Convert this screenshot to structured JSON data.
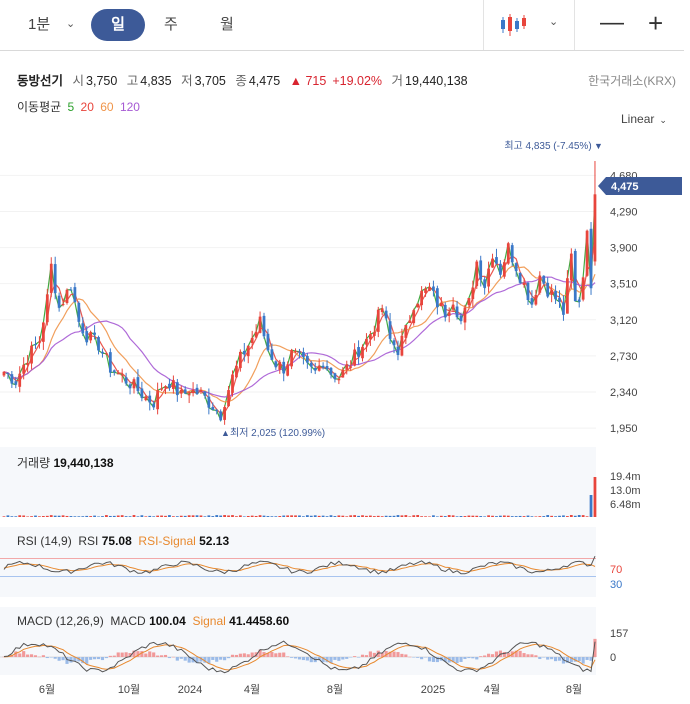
{
  "toolbar": {
    "timeframes": [
      "1분",
      "일",
      "주",
      "월"
    ],
    "active": "일",
    "chart_type_icon": "candlestick-icon",
    "zoom_out_icon": "minus-icon",
    "zoom_in_icon": "plus-icon"
  },
  "quote": {
    "name": "동방선기",
    "open_label": "시",
    "open": "3,750",
    "high_label": "고",
    "high": "4,835",
    "low_label": "저",
    "low": "3,705",
    "close_label": "종",
    "close": "4,475",
    "change": "▲ 715",
    "change_pct": "+19.02%",
    "volume_label": "거",
    "volume": "19,440,138",
    "exchange": "한국거래소(KRX)"
  },
  "ma_legend": {
    "label": "이동평균",
    "periods": [
      "5",
      "20",
      "60",
      "120"
    ],
    "colors": [
      "#2ca02c",
      "#e8453c",
      "#f0954a",
      "#a65ad4"
    ]
  },
  "scale_mode": "Linear",
  "colors": {
    "up": "#e8453c",
    "down": "#3a78c8",
    "accent": "#3d5a98",
    "signal": "#e8892e"
  },
  "chart_data": [
    {
      "type": "candlestick",
      "x_tick_labels": [
        "6월",
        "10월",
        "2024",
        "4월",
        "8월",
        "2025",
        "4월",
        "8월"
      ],
      "y_tick_labels": [
        "4,680",
        "4,290",
        "3,900",
        "3,510",
        "3,120",
        "2,730",
        "2,340",
        "1,950"
      ],
      "ylim": [
        1800,
        4900
      ],
      "last_price_label": "4,475",
      "last_price": 4475,
      "high_annotation": "최고 4,835 (-7.45%)",
      "high_value": 4835,
      "low_annotation": "최저 2,025 (120.99%)",
      "low_value": 2025,
      "moving_averages": [
        "5",
        "20",
        "60",
        "120"
      ],
      "price_path": [
        [
          0,
          2560
        ],
        [
          3,
          2460
        ],
        [
          6,
          2720
        ],
        [
          9,
          2900
        ],
        [
          11,
          3350
        ],
        [
          12,
          3700
        ],
        [
          14,
          3250
        ],
        [
          17,
          3500
        ],
        [
          19,
          3100
        ],
        [
          21,
          2950
        ],
        [
          24,
          2850
        ],
        [
          27,
          2600
        ],
        [
          30,
          2500
        ],
        [
          33,
          2400
        ],
        [
          36,
          2280
        ],
        [
          38,
          2230
        ],
        [
          40,
          2400
        ],
        [
          42,
          2450
        ],
        [
          45,
          2300
        ],
        [
          47,
          2360
        ],
        [
          50,
          2320
        ],
        [
          52,
          2230
        ],
        [
          54,
          2150
        ],
        [
          55,
          2100
        ],
        [
          56,
          2250
        ],
        [
          58,
          2500
        ],
        [
          60,
          2700
        ],
        [
          62,
          2850
        ],
        [
          64,
          3000
        ],
        [
          65,
          3100
        ],
        [
          67,
          2800
        ],
        [
          69,
          2650
        ],
        [
          71,
          2600
        ],
        [
          73,
          2750
        ],
        [
          75,
          2700
        ],
        [
          77,
          2600
        ],
        [
          79,
          2550
        ],
        [
          81,
          2680
        ],
        [
          83,
          2550
        ],
        [
          85,
          2500
        ],
        [
          88,
          2650
        ],
        [
          90,
          2800
        ],
        [
          92,
          2900
        ],
        [
          94,
          3050
        ],
        [
          96,
          3250
        ],
        [
          98,
          2900
        ],
        [
          100,
          2800
        ],
        [
          102,
          3000
        ],
        [
          104,
          3300
        ],
        [
          106,
          3400
        ],
        [
          108,
          3450
        ],
        [
          110,
          3300
        ],
        [
          112,
          3200
        ],
        [
          114,
          3350
        ],
        [
          116,
          3100
        ],
        [
          118,
          3300
        ],
        [
          120,
          3750
        ],
        [
          122,
          3500
        ],
        [
          124,
          3850
        ],
        [
          126,
          3650
        ],
        [
          128,
          3900
        ],
        [
          130,
          3700
        ],
        [
          132,
          3500
        ],
        [
          134,
          3300
        ],
        [
          136,
          3600
        ],
        [
          138,
          3450
        ],
        [
          140,
          3350
        ],
        [
          142,
          3200
        ],
        [
          144,
          3800
        ],
        [
          145,
          3300
        ],
        [
          146,
          3350
        ],
        [
          147,
          3600
        ],
        [
          148,
          4150
        ],
        [
          149,
          3400
        ],
        [
          150,
          3475
        ]
      ]
    },
    {
      "type": "bar",
      "panel_label": "거래량",
      "value_label": "19,440,138",
      "last_value": 19440138,
      "y_tick_labels": [
        "19.4m",
        "13.0m",
        "6.48m"
      ]
    },
    {
      "type": "line",
      "panel_label": "RSI (14,9)",
      "rsi_label": "RSI",
      "rsi_value": "75.08",
      "signal_label": "RSI-Signal",
      "signal_value": "52.13",
      "levels": [
        "70",
        "30"
      ],
      "ylim": [
        0,
        100
      ]
    },
    {
      "type": "line",
      "panel_label": "MACD (12,26,9)",
      "macd_label": "MACD",
      "macd_value": "100.04",
      "signal_label": "Signal",
      "signal_value": "41.4458.60",
      "y_tick_labels": [
        "157",
        "0"
      ]
    }
  ]
}
